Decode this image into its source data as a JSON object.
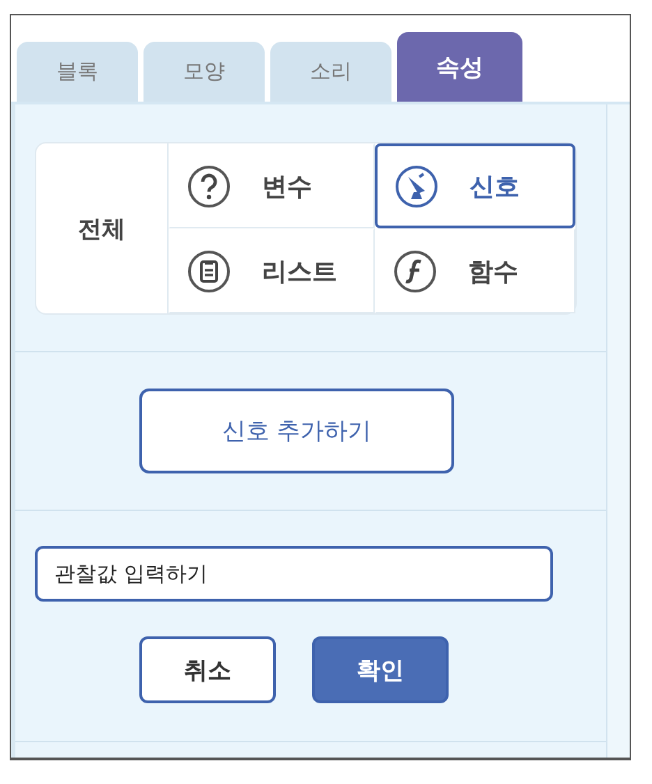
{
  "tabs": [
    {
      "label": "블록",
      "selected": false
    },
    {
      "label": "모양",
      "selected": false
    },
    {
      "label": "소리",
      "selected": false
    },
    {
      "label": "속성",
      "selected": true
    }
  ],
  "categories": {
    "all_label": "전체",
    "items": [
      {
        "label": "변수",
        "kind": "question",
        "selected": false
      },
      {
        "label": "신호",
        "kind": "signal",
        "selected": true
      },
      {
        "label": "리스트",
        "kind": "list",
        "selected": false
      },
      {
        "label": "함수",
        "kind": "function",
        "selected": false
      }
    ]
  },
  "add_button": "신호 추가하기",
  "input": {
    "value": "관찰값 입력하기"
  },
  "buttons": [
    {
      "label": "취소",
      "kind": "secondary"
    },
    {
      "label": "확인",
      "kind": "primary"
    }
  ]
}
